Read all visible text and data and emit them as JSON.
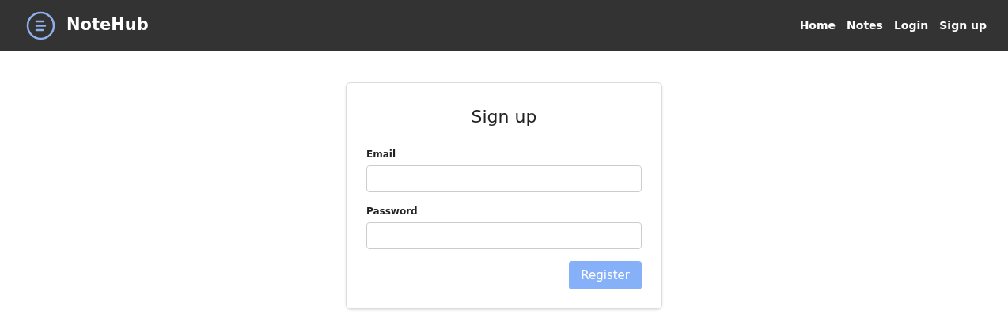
{
  "header": {
    "brand": "NoteHub",
    "nav": [
      {
        "label": "Home"
      },
      {
        "label": "Notes"
      },
      {
        "label": "Login"
      },
      {
        "label": "Sign up"
      }
    ]
  },
  "form": {
    "title": "Sign up",
    "fields": [
      {
        "label": "Email"
      },
      {
        "label": "Password"
      }
    ],
    "submit": {
      "label": "Register",
      "disabled": true
    }
  }
}
